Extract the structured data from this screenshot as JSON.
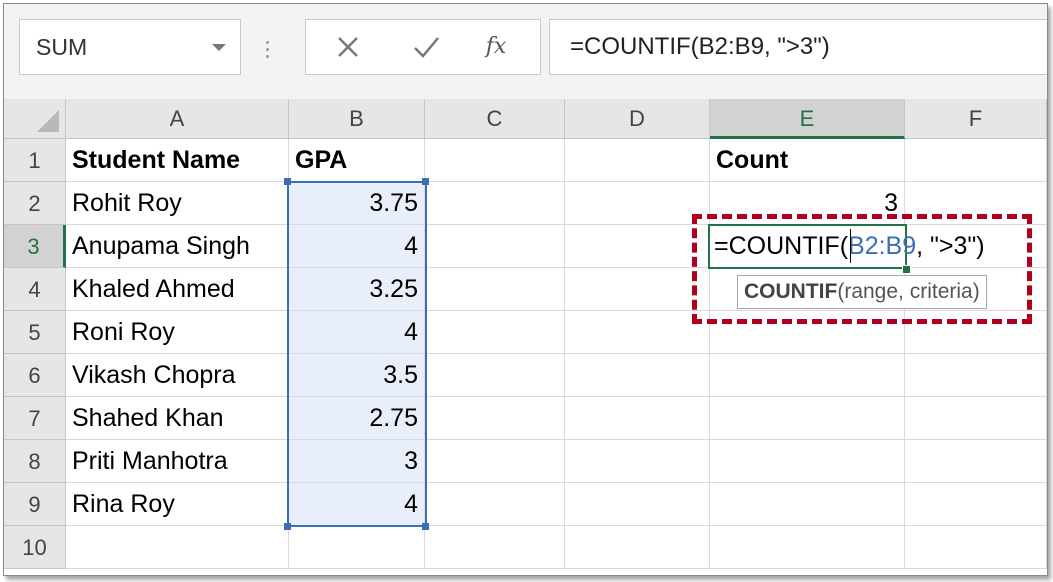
{
  "name_box": {
    "value": "SUM"
  },
  "formula_bar": {
    "cancel_icon": "close-icon",
    "enter_icon": "check-icon",
    "fx_label": "fx",
    "formula": "=COUNTIF(B2:B9, \">3\")"
  },
  "columns": [
    "A",
    "B",
    "C",
    "D",
    "E",
    "F"
  ],
  "rows": [
    "1",
    "2",
    "3",
    "4",
    "5",
    "6",
    "7",
    "8",
    "9",
    "10"
  ],
  "cells": {
    "A1": "Student Name",
    "B1": "GPA",
    "E1": "Count",
    "E2": "3",
    "A2": "Rohit Roy",
    "B2": "3.75",
    "A3": "Anupama Singh",
    "B3": "4",
    "A4": "Khaled Ahmed",
    "B4": "3.25",
    "A5": "Roni Roy",
    "B5": "4",
    "A6": "Vikash Chopra",
    "B6": "3.5",
    "A7": "Shahed Khan",
    "B7": "2.75",
    "A8": "Priti Manhotra",
    "B8": "3",
    "A9": "Rina Roy",
    "B9": "4"
  },
  "edit_cell": {
    "prefix": "=COUNTIF",
    "paren": "(",
    "ref": "B2:B9",
    "rest": ", \">3\")"
  },
  "tooltip": {
    "func": "COUNTIF",
    "args": "(range, criteria)"
  },
  "colors": {
    "accent_green": "#217346",
    "range_blue": "#3d6db5",
    "highlight_red": "#b0001c"
  }
}
